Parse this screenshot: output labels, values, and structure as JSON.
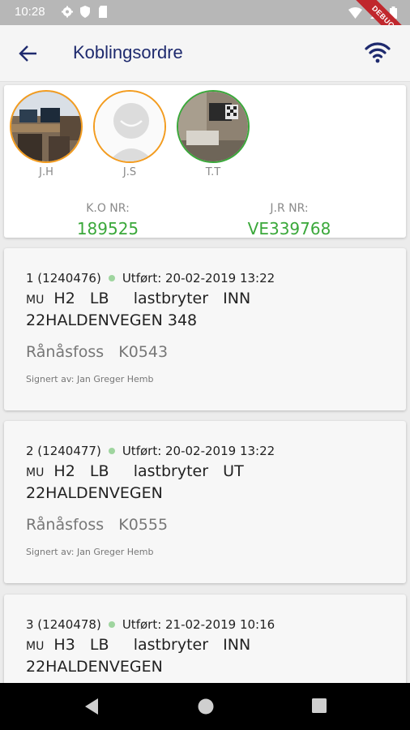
{
  "status_bar": {
    "time": "10:28",
    "debug_banner": "DEBUG",
    "icons": [
      "gear-icon",
      "shield-icon",
      "sim-card-icon",
      "wifi-signal-icon",
      "cell-signal-icon",
      "battery-icon"
    ]
  },
  "app_bar": {
    "title": "Koblingsordre"
  },
  "header": {
    "avatars": [
      {
        "initials": "J.H",
        "ring_color": "#f39c1f"
      },
      {
        "initials": "J.S",
        "ring_color": "#f39c1f"
      },
      {
        "initials": "T.T",
        "ring_color": "#3aa83a"
      }
    ],
    "ko_label": "K.O NR:",
    "ko_value": "189525",
    "jr_label": "J.R NR:",
    "jr_value": "VE339768"
  },
  "orders": [
    {
      "id": "1 (1240476)",
      "status": "Utført: 20-02-2019 13:22",
      "mu": "MU",
      "detail": "  H2   LB     lastbryter   INN",
      "address": "22HALDENVEGEN 348",
      "location": "Rånåsfoss   K0543",
      "signed": "Signert av: Jan Greger Hemb"
    },
    {
      "id": "2 (1240477)",
      "status": "Utført: 20-02-2019 13:22",
      "mu": "MU",
      "detail": "  H2   LB     lastbryter   UT",
      "address": "22HALDENVEGEN",
      "location": "Rånåsfoss   K0555",
      "signed": "Signert av: Jan Greger Hemb"
    },
    {
      "id": "3 (1240478)",
      "status": "Utført: 21-02-2019 10:16",
      "mu": "MU",
      "detail": "  H3   LB     lastbryter   INN",
      "address": "22HALDENVEGEN",
      "location": "",
      "signed": ""
    }
  ],
  "colors": {
    "accent_green": "#3aa83a",
    "accent_orange": "#f39c1f",
    "title_blue": "#1e2a6e",
    "status_dot": "#9fd59f"
  },
  "nav_bar": {
    "icons": [
      "back-triangle-icon",
      "home-circle-icon",
      "recents-square-icon"
    ]
  }
}
